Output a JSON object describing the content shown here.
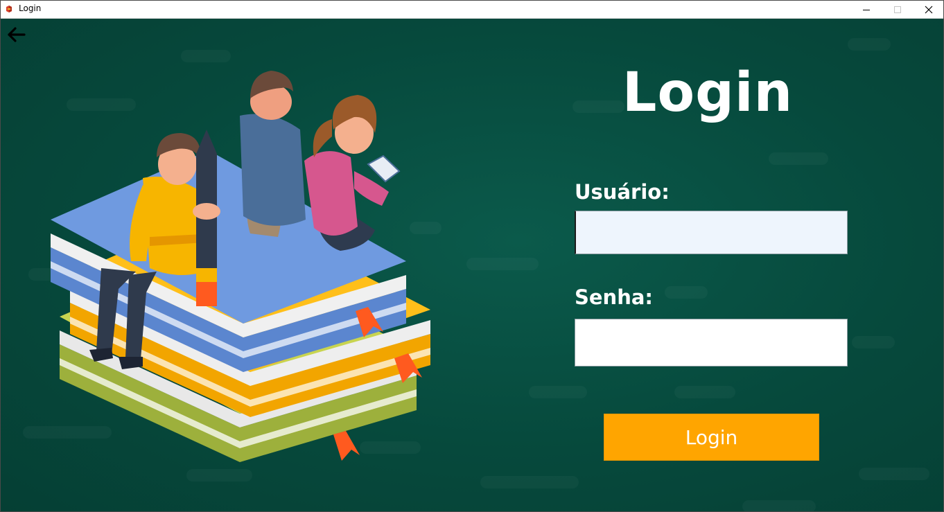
{
  "window": {
    "title": "Login"
  },
  "icons": {
    "app": "app-icon",
    "back": "arrow-left-icon",
    "minimize": "minimize-icon",
    "maximize": "maximize-icon",
    "close": "close-icon"
  },
  "colors": {
    "background": "#06493c",
    "accent_button": "#ffa500",
    "text": "#ffffff",
    "input_focused_bg": "#eef5fd"
  },
  "form": {
    "heading": "Login",
    "user_label": "Usuário:",
    "user_value": "",
    "password_label": "Senha:",
    "password_value": "",
    "submit_label": "Login"
  }
}
